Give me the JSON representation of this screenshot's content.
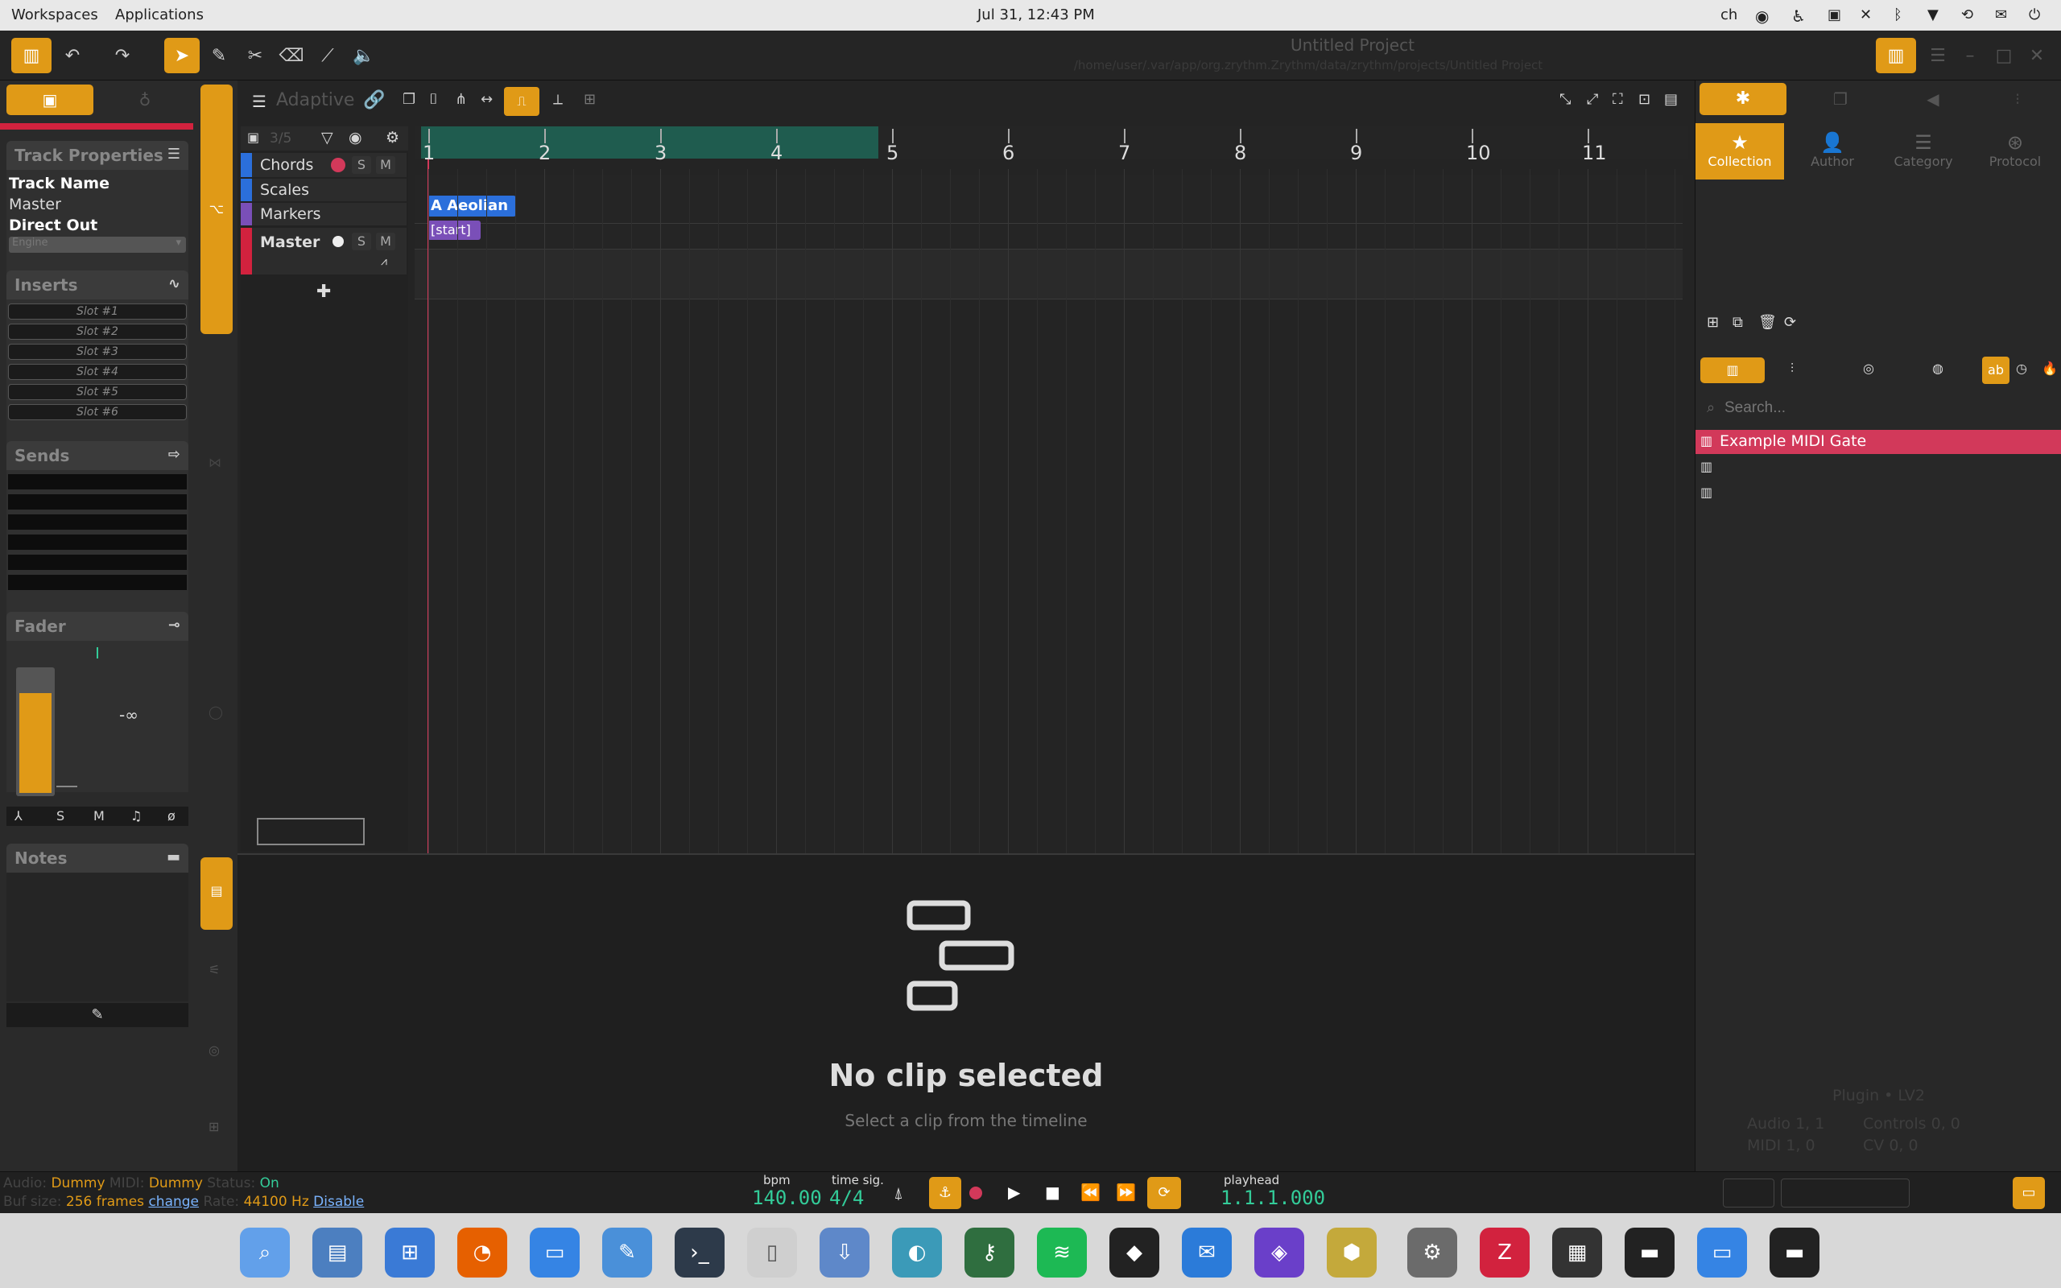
{
  "system": {
    "workspaces": "Workspaces",
    "applications": "Applications",
    "clock": "Jul 31, 12:43 PM",
    "lang": "ch"
  },
  "window": {
    "title": "Untitled Project",
    "path": "/home/user/.var/app/org.zrythm.Zrythm/data/zrythm/projects/Untitled Project"
  },
  "toolbar": {
    "snap_mode": "Adaptive"
  },
  "left": {
    "track_properties": "Track Properties",
    "track_name_label": "Track Name",
    "track_name": "Master",
    "direct_out_label": "Direct Out",
    "direct_out_value": "Engine",
    "inserts": "Inserts",
    "slots": [
      "Slot #1",
      "Slot #2",
      "Slot #3",
      "Slot #4",
      "Slot #5",
      "Slot #6"
    ],
    "sends": "Sends",
    "fader": "Fader",
    "fader_value": "-∞",
    "fader_buttons": [
      "⅄",
      "S",
      "M",
      "♫",
      "ø"
    ],
    "notes": "Notes"
  },
  "tracklist": {
    "count": "3/5",
    "tracks": [
      {
        "name": "Chords",
        "color": "#2b6fdb"
      },
      {
        "name": "Scales",
        "color": "#2b6fdb"
      },
      {
        "name": "Markers",
        "color": "#7a4fb8"
      },
      {
        "name": "Master",
        "color": "#d2223e"
      }
    ],
    "solo": "S",
    "mute": "M"
  },
  "timeline": {
    "bars": [
      "1",
      "2",
      "3",
      "4",
      "5",
      "6",
      "7",
      "8",
      "9",
      "10",
      "11"
    ],
    "scale_region": "A Aeolian",
    "marker_region": "[start]"
  },
  "editor": {
    "empty_title": "No clip selected",
    "empty_sub": "Select a clip from the timeline"
  },
  "right": {
    "tabs": [
      "Collection",
      "Author",
      "Category",
      "Protocol"
    ],
    "search_placeholder": "Search...",
    "plugins": [
      "Example MIDI Gate"
    ],
    "plugin_info_title": "Plugin • LV2",
    "audio_label": "Audio",
    "audio_value": "1, 1",
    "midi_label": "MIDI",
    "midi_value": "1, 0",
    "controls_label": "Controls",
    "controls_value": "0, 0",
    "cv_label": "CV",
    "cv_value": "0, 0"
  },
  "status": {
    "audio_label": "Audio:",
    "audio_backend": "Dummy",
    "midi_label": "MIDI:",
    "midi_backend": "Dummy",
    "status_label": "Status:",
    "status_value": "On",
    "buf_label": "Buf size:",
    "buf_value": "256 frames",
    "change": "change",
    "rate_label": "Rate:",
    "rate_value": "44100 Hz",
    "disable": "Disable",
    "bpm_label": "bpm",
    "bpm": "140.00",
    "timesig_label": "time sig.",
    "timesig": "4/4",
    "playhead_label": "playhead",
    "playhead": "1.1.1.000"
  }
}
